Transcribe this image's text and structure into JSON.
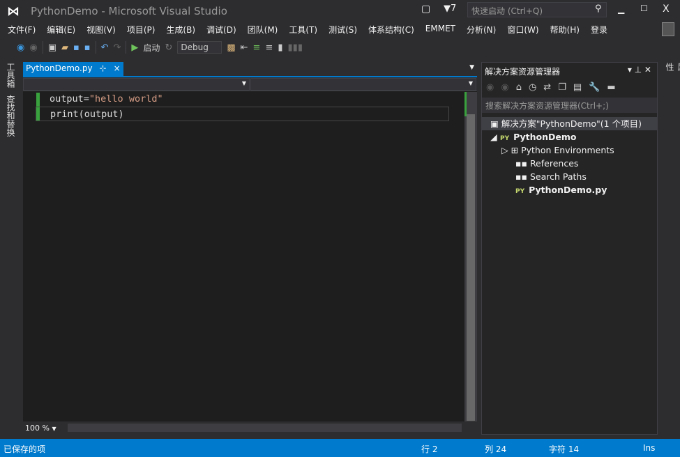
{
  "window": {
    "title": "PythonDemo - Microsoft Visual Studio",
    "notifications": "7",
    "quick_launch_placeholder": "快速启动 (Ctrl+Q)",
    "minimize": "▁",
    "maximize": "☐",
    "close": "X"
  },
  "menu": [
    "文件(F)",
    "编辑(E)",
    "视图(V)",
    "项目(P)",
    "生成(B)",
    "调试(D)",
    "团队(M)",
    "工具(T)",
    "测试(S)",
    "体系结构(C)",
    "EMMET",
    "分析(N)",
    "窗口(W)",
    "帮助(H)",
    "登录"
  ],
  "toolbar": {
    "start_label": "启动",
    "config": "Debug"
  },
  "left_strip": {
    "toolbox": "工具箱",
    "find_replace": "查找和替换"
  },
  "right_strip": {
    "properties": "属性"
  },
  "editor": {
    "tab_label": "PythonDemo.py",
    "pin": "⊹",
    "close": "×",
    "lines": [
      {
        "var": "output",
        "op": "=",
        "str": "\"hello world\""
      },
      {
        "text": "print(output)"
      }
    ],
    "zoom": "100 %"
  },
  "solution_explorer": {
    "title": "解决方案资源管理器",
    "search_placeholder": "搜索解决方案资源管理器(Ctrl+;)",
    "solution": "解决方案\"PythonDemo\"(1 个项目)",
    "project": "PythonDemo",
    "items": [
      "Python Environments",
      "References",
      "Search Paths",
      "PythonDemo.py"
    ]
  },
  "status": {
    "message": "已保存的项",
    "row": "行 2",
    "col": "列 24",
    "char": "字符 14",
    "mode": "Ins"
  }
}
